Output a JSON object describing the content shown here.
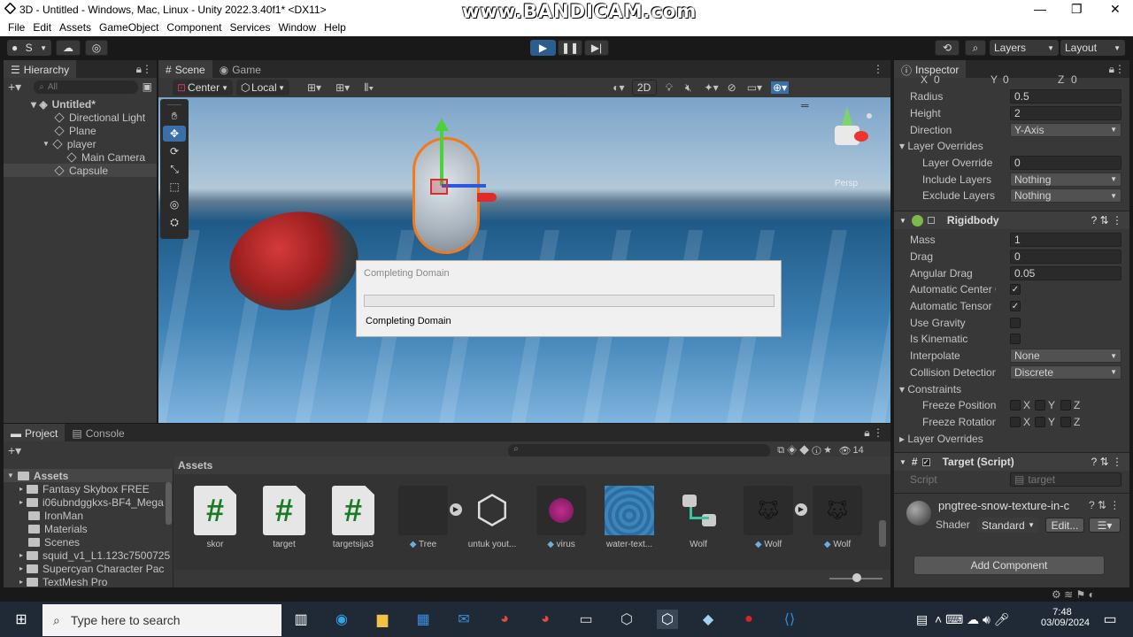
{
  "window": {
    "title": "3D - Untitled - Windows, Mac, Linux - Unity 2022.3.40f1* <DX11>",
    "watermark": "www.BANDICAM.com",
    "minimize": "—",
    "maximize": "❐",
    "close": "✕"
  },
  "menu": [
    "File",
    "Edit",
    "Assets",
    "GameObject",
    "Component",
    "Services",
    "Window",
    "Help"
  ],
  "toolbar": {
    "account": "S",
    "layers": "Layers",
    "layout": "Layout"
  },
  "hierarchy": {
    "tab": "Hierarchy",
    "search_placeholder": "All",
    "scene": "Untitled*",
    "items": [
      "Directional Light",
      "Plane",
      "player",
      "Main Camera",
      "Capsule"
    ]
  },
  "scene_view": {
    "tab_scene": "Scene",
    "tab_game": "Game",
    "pivot": "Center",
    "space": "Local",
    "mode_2d": "2D",
    "gizmo_label": "Persp"
  },
  "dialog": {
    "title": "Completing Domain",
    "status": "Completing Domain",
    "progress": 0
  },
  "inspector": {
    "tab": "Inspector",
    "xyz": {
      "x_label": "X",
      "x": "0",
      "y_label": "Y",
      "y": "0",
      "z_label": "Z",
      "z": "0"
    },
    "collider": [
      {
        "label": "Radius",
        "value": "0.5"
      },
      {
        "label": "Height",
        "value": "2"
      }
    ],
    "direction_label": "Direction",
    "direction": "Y-Axis",
    "layer_overrides": "Layer Overrides",
    "layer_override_priority_label": "Layer Override Prio",
    "layer_override_priority": "0",
    "include_layers_label": "Include Layers",
    "include_layers": "Nothing",
    "exclude_layers_label": "Exclude Layers",
    "exclude_layers": "Nothing",
    "rigidbody": {
      "title": "Rigidbody",
      "mass_label": "Mass",
      "mass": "1",
      "drag_label": "Drag",
      "drag": "0",
      "angular_drag_label": "Angular Drag",
      "angular_drag": "0.05",
      "auto_com_label": "Automatic Center Of M",
      "auto_tensor_label": "Automatic Tensor",
      "use_gravity_label": "Use Gravity",
      "is_kinematic_label": "Is Kinematic",
      "interpolate_label": "Interpolate",
      "interpolate": "None",
      "collision_label": "Collision Detection",
      "collision": "Discrete",
      "constraints": "Constraints",
      "freeze_position": "Freeze Position",
      "freeze_rotation": "Freeze Rotation",
      "x": "X",
      "y": "Y",
      "z": "Z",
      "layer_overrides": "Layer Overrides",
      "checks": {
        "auto_com": true,
        "auto_tensor": true,
        "use_gravity": false,
        "is_kinematic": false
      }
    },
    "target_script": {
      "title": "Target (Script)",
      "script_label": "Script",
      "script_value": "target"
    },
    "material": {
      "name": "pngtree-snow-texture-in-c",
      "shader_label": "Shader",
      "shader": "Standard",
      "edit": "Edit..."
    },
    "add_component": "Add Component"
  },
  "project": {
    "tab_project": "Project",
    "tab_console": "Console",
    "hidden_count": "14",
    "breadcrumb": "Assets",
    "tree_root": "Assets",
    "tree": [
      "Fantasy Skybox FREE",
      "i06ubndggkxs-BF4_Mega",
      "IronMan",
      "Materials",
      "Scenes",
      "squid_v1_L1.123c7500725",
      "Supercyan Character Pac",
      "TextMesh Pro"
    ],
    "assets": [
      {
        "name": "skor",
        "kind": "script"
      },
      {
        "name": "target",
        "kind": "script"
      },
      {
        "name": "targetsija3",
        "kind": "script"
      },
      {
        "name": "Tree",
        "kind": "prefab"
      },
      {
        "name": "untuk yout...",
        "kind": "unity"
      },
      {
        "name": "virus",
        "kind": "prefab"
      },
      {
        "name": "water-text...",
        "kind": "texture"
      },
      {
        "name": "Wolf",
        "kind": "animator"
      },
      {
        "name": "Wolf",
        "kind": "prefab"
      },
      {
        "name": "Wolf",
        "kind": "prefab"
      }
    ]
  },
  "taskbar": {
    "search_placeholder": "Type here to search",
    "time": "7:48",
    "date": "03/09/2024"
  },
  "colors": {
    "accent_blue": "#3a79bb",
    "script_green": "#1a7a25",
    "panel": "#383838",
    "dark": "#191919"
  }
}
